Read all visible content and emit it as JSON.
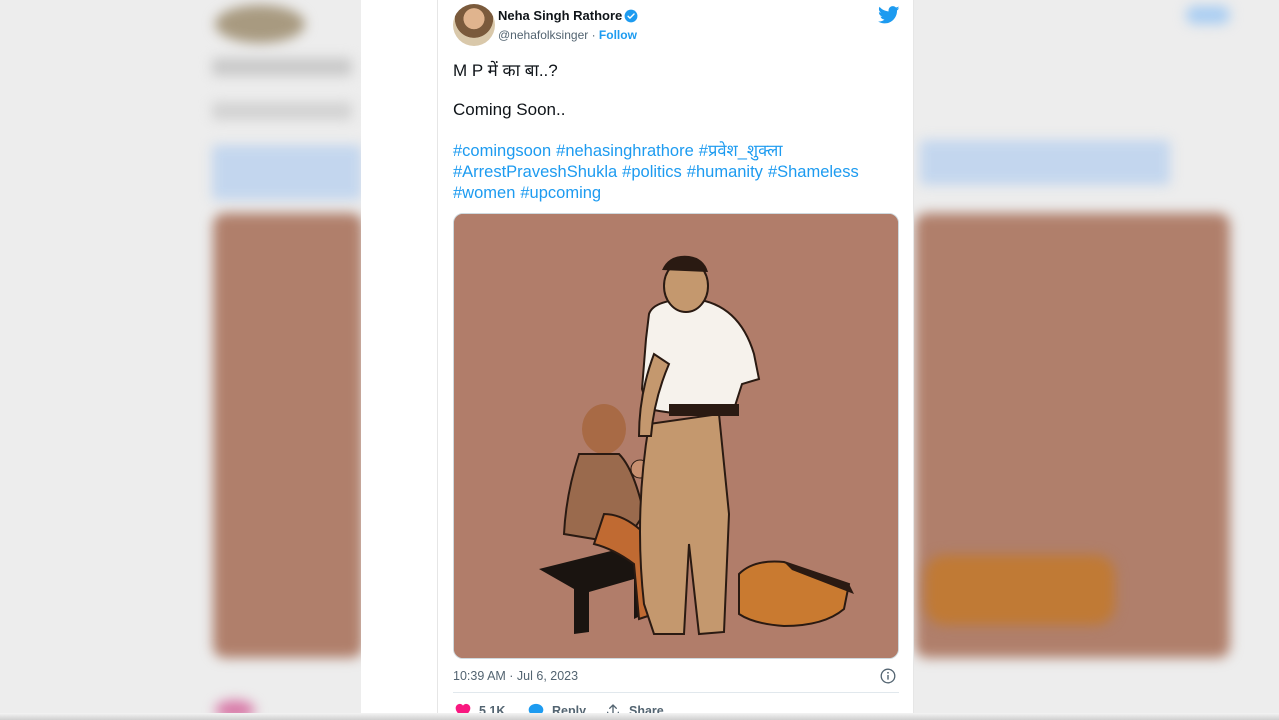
{
  "tweet": {
    "author_name": "Neha Singh Rathore",
    "handle": "@nehafolksinger",
    "separator": " · ",
    "follow_label": "Follow",
    "line1": "M P में का बा..?",
    "line2": "Coming Soon..",
    "hashtags": [
      "#comingsoon",
      "#nehasinghrathore",
      "#प्रवेश_शुक्ला",
      "#ArrestPraveshShukla",
      "#politics",
      "#humanity",
      "#Shameless",
      "#women",
      "#upcoming"
    ],
    "timestamp": "10:39 AM · Jul 6, 2023",
    "likes": "5.1K",
    "reply_label": "Reply",
    "share_label": "Share"
  },
  "icons": {
    "verified": "verified-badge-icon",
    "logo": "twitter-bird-icon",
    "info": "info-icon",
    "like": "heart-icon",
    "reply": "speech-bubble-icon",
    "share": "share-arrow-icon"
  },
  "colors": {
    "accent": "#1d9bf0",
    "like": "#f91880",
    "media_bg": "#b17d6a"
  }
}
